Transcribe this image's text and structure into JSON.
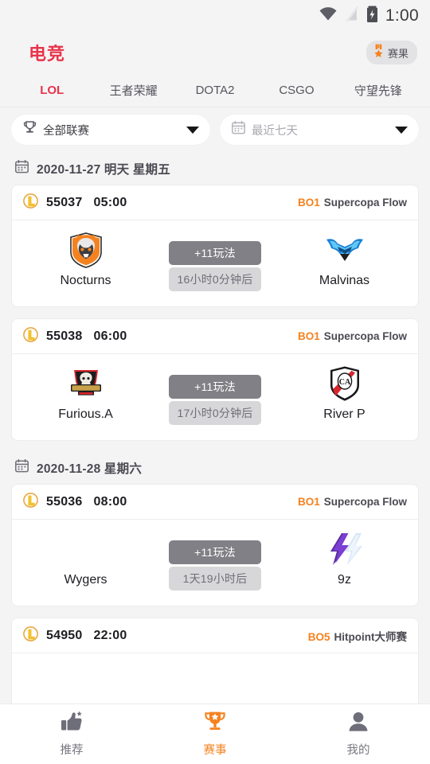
{
  "statusbar": {
    "time": "1:00",
    "wifi_icon": "wifi-icon",
    "signal_icon": "signal-off-icon",
    "battery_icon": "battery-charging-icon"
  },
  "header": {
    "brand": "电竞",
    "result_button": {
      "label": "赛果",
      "icon": "medal-icon"
    }
  },
  "tabs": [
    {
      "label": "LOL",
      "active": true
    },
    {
      "label": "王者荣耀",
      "active": false
    },
    {
      "label": "DOTA2",
      "active": false
    },
    {
      "label": "CSGO",
      "active": false
    },
    {
      "label": "守望先锋",
      "active": false
    }
  ],
  "filters": {
    "league": {
      "value": "全部联赛",
      "icon": "trophy-icon",
      "placeholder": false
    },
    "date": {
      "placeholder_text": "最近七天",
      "icon": "calendar-icon",
      "placeholder": true
    }
  },
  "groups": [
    {
      "date_label": "2020-11-27 明天 星期五",
      "date_icon": "calendar-icon",
      "matches": [
        {
          "id": "55037",
          "time": "05:00",
          "bo": "BO1",
          "league": "Supercopa Flow",
          "league_icon": "lol-icon",
          "home": {
            "name": "Nocturns",
            "logo": "nocturns-logo",
            "has_logo": true
          },
          "away": {
            "name": "Malvinas",
            "logo": "malvinas-logo",
            "has_logo": true
          },
          "play_badge": "+11玩法",
          "countdown": "16小时0分钟后"
        },
        {
          "id": "55038",
          "time": "06:00",
          "bo": "BO1",
          "league": "Supercopa Flow",
          "league_icon": "lol-icon",
          "home": {
            "name": "Furious.A",
            "logo": "furious-logo",
            "has_logo": true
          },
          "away": {
            "name": "River P",
            "logo": "riverplate-logo",
            "has_logo": true
          },
          "play_badge": "+11玩法",
          "countdown": "17小时0分钟后"
        }
      ]
    },
    {
      "date_label": "2020-11-28 星期六",
      "date_icon": "calendar-icon",
      "matches": [
        {
          "id": "55036",
          "time": "08:00",
          "bo": "BO1",
          "league": "Supercopa Flow",
          "league_icon": "lol-icon",
          "home": {
            "name": "Wygers",
            "logo": "",
            "has_logo": false
          },
          "away": {
            "name": "9z",
            "logo": "9z-logo",
            "has_logo": true
          },
          "play_badge": "+11玩法",
          "countdown": "1天19小时后"
        },
        {
          "id": "54950",
          "time": "22:00",
          "bo": "BO5",
          "league": "Hitpoint大师赛",
          "league_icon": "lol-icon",
          "home": {
            "name": "",
            "logo": "",
            "has_logo": false
          },
          "away": {
            "name": "",
            "logo": "",
            "has_logo": false
          },
          "play_badge": "",
          "countdown": ""
        }
      ]
    }
  ],
  "bottom_nav": [
    {
      "label": "推荐",
      "icon": "thumbs-up-icon",
      "active": false
    },
    {
      "label": "赛事",
      "icon": "trophy-icon",
      "active": true
    },
    {
      "label": "我的",
      "icon": "person-icon",
      "active": false
    }
  ],
  "colors": {
    "brand_red": "#e8334a",
    "accent_orange": "#f5821f",
    "page_bg": "#f4f4f5",
    "card_bg": "#ffffff"
  }
}
